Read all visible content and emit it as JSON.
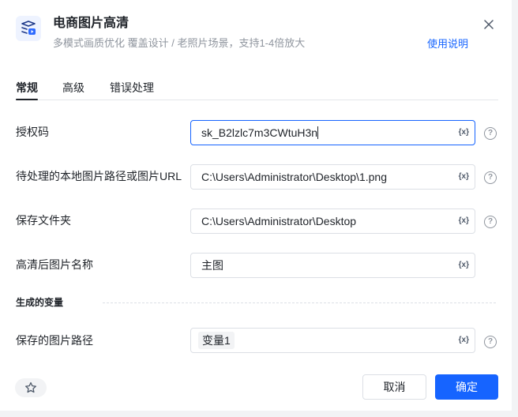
{
  "header": {
    "title": "电商图片高清",
    "subtitle": "多模式画质优化 覆盖设计 / 老照片场景，支持1-4倍放大",
    "help_link": "使用说明",
    "icon": "image-enhance-icon"
  },
  "tabs": [
    {
      "label": "常规",
      "active": true
    },
    {
      "label": "高级",
      "active": false
    },
    {
      "label": "错误处理",
      "active": false
    }
  ],
  "fields": [
    {
      "label": "授权码",
      "value": "sk_B2lzlc7m3CWtuH3n",
      "var_label": "{x}"
    },
    {
      "label": "待处理的本地图片路径或图片URL",
      "value": "C:\\Users\\Administrator\\Desktop\\1.png",
      "var_label": "{x}"
    },
    {
      "label": "保存文件夹",
      "value": "C:\\Users\\Administrator\\Desktop",
      "var_label": "{x}"
    },
    {
      "label": "高清后图片名称",
      "value": "主图",
      "var_label": "{x}"
    }
  ],
  "output_section": {
    "title": "生成的变量",
    "field": {
      "label": "保存的图片路径",
      "value": "变量1",
      "var_label": "{x}"
    }
  },
  "help_icon_glyph": "?",
  "footer": {
    "cancel_label": "取消",
    "ok_label": "确定"
  },
  "colors": {
    "accent": "#1664ff",
    "text": "#1f2329",
    "muted": "#8f959e",
    "border": "#dcdfe5"
  }
}
